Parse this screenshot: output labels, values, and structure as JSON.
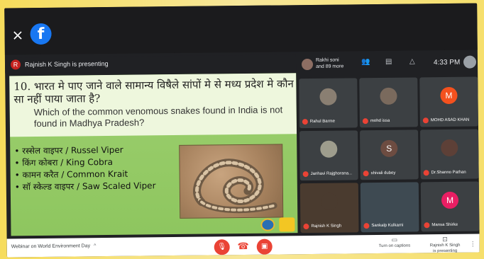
{
  "header": {
    "close_label": "×",
    "facebook_logo": "f"
  },
  "presenting": {
    "avatar_letter": "R",
    "text": "Rajnish K Singh is presenting"
  },
  "slide": {
    "question_hindi": "10. भारत मे पाए जाने वाले सामान्य विषैले सांपों मे से मध्य प्रदेश मे कौन सा नहीं पाया जाता है?",
    "question_english": "Which of the common venomous snakes found in India is not found in Madhya Pradesh?",
    "options": [
      "• रस्सेल वाइपर / Russel Viper",
      "• किंग कोबरा / King Cobra",
      "• कामन करैत / Common Krait",
      "• सॉ स्केल्ड वाइपर / Saw Scaled Viper"
    ]
  },
  "topbar": {
    "viewers_line1": "Rakhi soni",
    "viewers_line2": "and 89 more",
    "clock": "4:33 PM",
    "people_icon": "people-icon",
    "chat_icon": "chat-icon",
    "activities_icon": "activities-icon"
  },
  "participants": [
    {
      "name": "Rahul Barme",
      "avatar": "",
      "color": "#8a7f72"
    },
    {
      "name": "mohd issa",
      "avatar": "",
      "color": "#7a6a5d"
    },
    {
      "name": "MOHD ASAD KHAN",
      "avatar": "M",
      "color": "#f4511e"
    },
    {
      "name": "Janhavi Rajghorana...",
      "avatar": "",
      "color": "#9e9d8d"
    },
    {
      "name": "shivali dubey",
      "avatar": "S",
      "color": "#6d4c41"
    },
    {
      "name": "Dr.Shanno Pathan",
      "avatar": "",
      "color": "#5d4037"
    },
    {
      "name": "Rajnish K Singh",
      "avatar": "",
      "color": "#4a3b2f"
    },
    {
      "name": "Sankalp Kulkarni",
      "avatar": "",
      "color": "#3e4a52"
    },
    {
      "name": "Mansa Shirke",
      "avatar": "M",
      "color": "#e91e63"
    }
  ],
  "bottom": {
    "meeting_name": "Webinar on World Environment Day",
    "caret": "^",
    "captions_label": "Turn on captions",
    "presenting_label_line1": "Rajnish K Singh",
    "presenting_label_line2": "is presenting",
    "mic_icon": "🎙",
    "hang_icon": "☎",
    "cam_icon": "▣",
    "more": "⋮"
  }
}
